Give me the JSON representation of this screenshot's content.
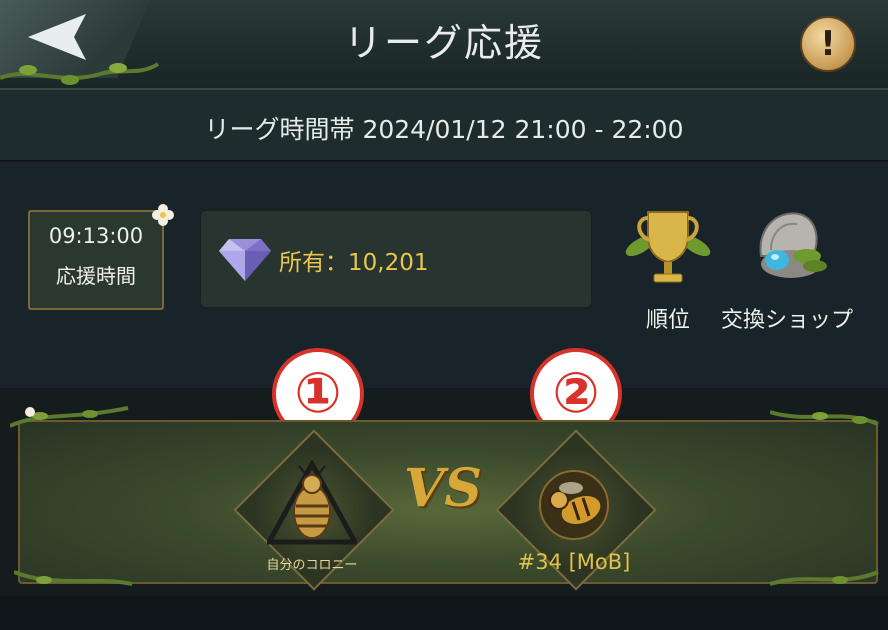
{
  "header": {
    "title": "リーグ応援",
    "info_label": "!"
  },
  "timeband": {
    "text": "リーグ時間帯 2024/01/12 21:00 - 22:00"
  },
  "cheer_time": {
    "time": "09:13:00",
    "label": "応援時間"
  },
  "gems": {
    "amount_text": "所有：10,201"
  },
  "actions": {
    "ranking_label": "順位",
    "shop_label": "交換ショップ"
  },
  "match": {
    "marker_left": "①",
    "marker_right": "②",
    "vs": "VS",
    "team_left_name": "自分のコロニー",
    "team_right_name": "#34 [MoB]"
  },
  "colors": {
    "accent_gold": "#e8c74a",
    "marker_red": "#d9322a",
    "panel_green": "#3b4a2c"
  }
}
